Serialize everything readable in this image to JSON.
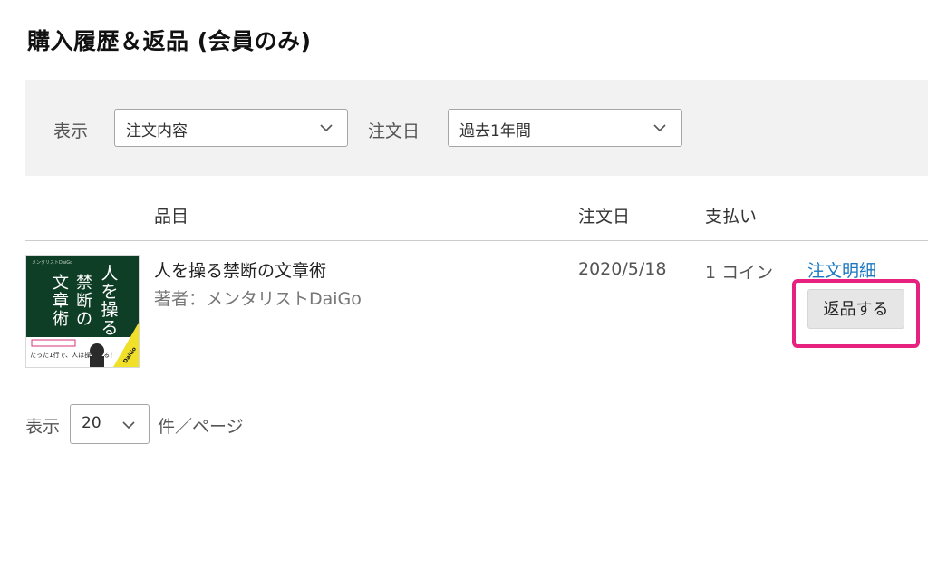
{
  "page": {
    "title": "購入履歴＆返品 (会員のみ)"
  },
  "filters": {
    "display_label": "表示",
    "display_value": "注文内容",
    "order_date_label": "注文日",
    "order_date_value": "過去1年間"
  },
  "table": {
    "headers": {
      "item": "品目",
      "order_date": "注文日",
      "payment": "支払い"
    },
    "rows": [
      {
        "title": "人を操る禁断の文章術",
        "author": "著者：メンタリストDaiGo",
        "order_date": "2020/5/18",
        "payment": "1 コイン",
        "detail_link": "注文明細",
        "return_button": "返品する",
        "cover": {
          "title_chars": [
            "人",
            "を",
            "操",
            "る",
            "禁",
            "断",
            "の",
            "文",
            "章",
            "術"
          ],
          "author_small": "メンタリストDaiGo",
          "band_text": "たった1行で、人は操られる！",
          "badge_text": "DaiGo",
          "cover_color": "#0e3e26",
          "accent_color": "#f0e02a"
        }
      }
    ]
  },
  "pagination": {
    "display_label": "表示",
    "per_page_value": "20",
    "per_page_suffix": "件／ページ"
  },
  "colors": {
    "link": "#1a78c2",
    "highlight": "#e6217f",
    "filter_bg": "#f2f2f2"
  }
}
